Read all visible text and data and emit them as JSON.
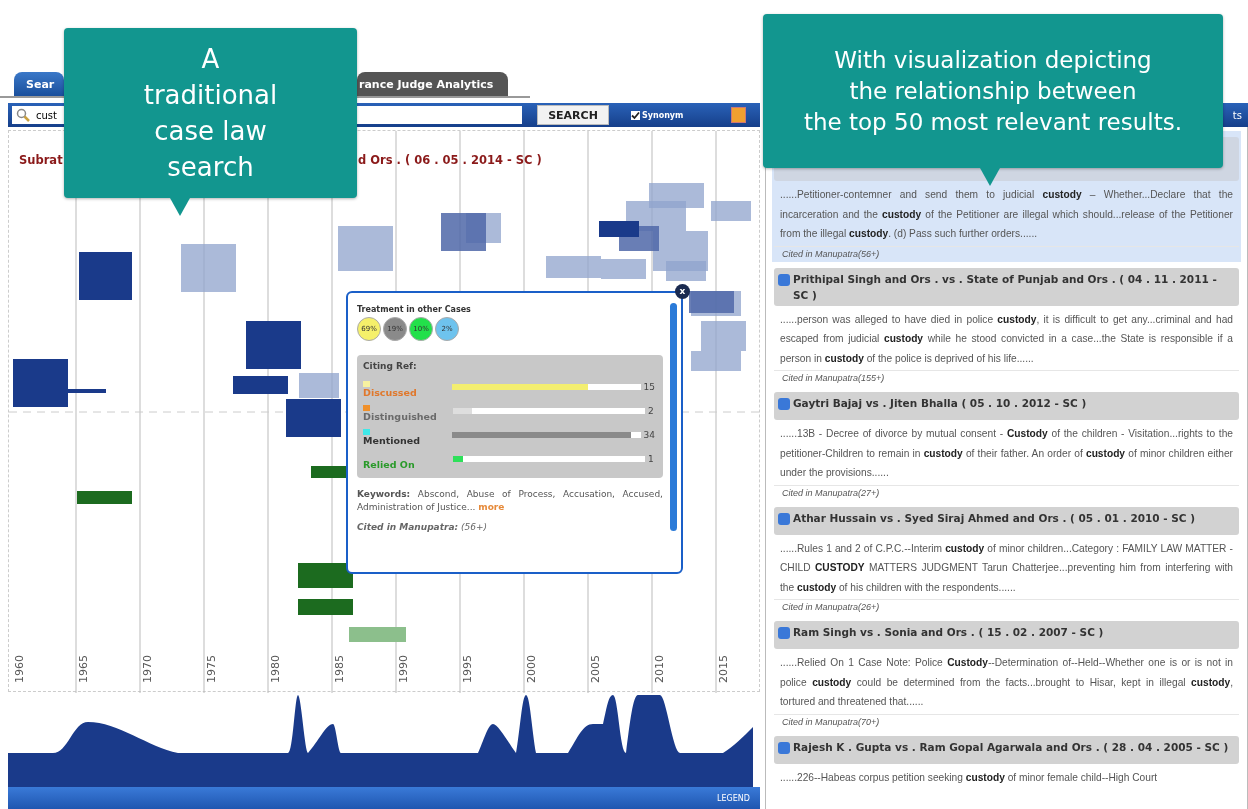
{
  "tabs": [
    {
      "label": "Sear",
      "selected": true
    },
    {
      "label": "rance Judge Analytics",
      "selected": false
    }
  ],
  "search": {
    "value": "cust",
    "button": "SEARCH",
    "synonym": {
      "label": "Synonym",
      "checked": true
    }
  },
  "timeline": {
    "title_parts": [
      "Subrat",
      "d Ors . ( 06 . 05 . 2014 - SC )"
    ],
    "years": [
      "1960",
      "1965",
      "1970",
      "1975",
      "1980",
      "1985",
      "1990",
      "1995",
      "2000",
      "2005",
      "2010",
      "2015"
    ]
  },
  "popup": {
    "close": "x",
    "treatment_title": "Treatment in other Cases",
    "treatments": [
      {
        "label": "69%",
        "color": "#f5f06a"
      },
      {
        "label": "19%",
        "color": "#8a8a8a"
      },
      {
        "label": "10%",
        "color": "#22e04a"
      },
      {
        "label": "2%",
        "color": "#6ec3ee"
      }
    ],
    "citing_title": "Citing Ref:",
    "citing": [
      {
        "kind": "discussed",
        "label": "Discussed",
        "value": "15",
        "level": 0.72,
        "color": "#f3ee70"
      },
      {
        "kind": "distinguished",
        "label": "Distinguished",
        "value": "2",
        "level": 0.1,
        "color": "#dedede"
      },
      {
        "kind": "mentioned",
        "label": "Mentioned",
        "value": "34",
        "level": 0.95,
        "color": "#8a8a8a"
      },
      {
        "kind": "relied",
        "label": "Relied On",
        "value": "1",
        "level": 0.05,
        "color": "#2ee05a"
      }
    ],
    "keywords": "**Keywords:** Abscond, Abuse of Process, Accusation, Accused, Administration of Justice...",
    "more": "more",
    "cited": "**Cited in Manupatra:** (56+)"
  },
  "legend": "LEGEND",
  "results_bar": "ts",
  "results": [
    {
      "selected": true,
      "snippet": "......Petitioner-contemner and send them to judicial **custody** – Whether...Declare that the incarceration and the **custody** of the Petitioner are illegal which should...release of the Petitioner from the illegal **custody**. (d) Pass such further orders......",
      "cited": "Cited in Manupatra(56+)"
    },
    {
      "selected": false,
      "title": "Prithipal Singh and Ors . vs . State of Punjab and Ors . ( 04 . 11 . 2011 - SC )",
      "snippet": "......person was alleged to have died in police **custody**, it is difficult to get any...criminal and had escaped from judicial **custody** while he stood convicted in a case...the State is responsible if a person in **custody** of the police is deprived of his life......",
      "cited": "Cited in Manupatra(155+)"
    },
    {
      "selected": false,
      "title": "Gaytri Bajaj vs . Jiten Bhalla ( 05 . 10 . 2012 - SC )",
      "snippet": "......13B - Decree of divorce by mutual consent - **Custody** of the children - Visitation...rights to the petitioner-Children to remain in **custody** of their father. An order of **custody** of minor children either under the provisions......",
      "cited": "Cited in Manupatra(27+)"
    },
    {
      "selected": false,
      "title": "Athar Hussain vs . Syed Siraj Ahmed and Ors . ( 05 . 01 . 2010 - SC )",
      "snippet": "......Rules 1 and 2 of C.P.C.--Interim **custody** of minor children...Category : FAMILY LAW MATTER - CHILD **CUSTODY** MATTERS JUDGMENT Tarun Chatterjee...preventing him from interfering with the **custody** of his children with the respondents......",
      "cited": "Cited in Manupatra(26+)"
    },
    {
      "selected": false,
      "title": "Ram Singh vs . Sonia and Ors . ( 15 . 02 . 2007 - SC )",
      "snippet": "......Relied On 1 Case Note: Police **Custody**--Determination of--Held--Whether one is or is not in police **custody** could be determined from the facts...brought to Hisar, kept in illegal **custody**, tortured and threatened that......",
      "cited": "Cited in Manupatra(70+)"
    },
    {
      "selected": false,
      "title": "Rajesh K . Gupta vs . Ram Gopal Agarwala and Ors . ( 28 . 04 . 2005 - SC )",
      "snippet": "......226--Habeas corpus petition seeking **custody** of minor female child--High Court"
    }
  ],
  "callouts": [
    {
      "lines": [
        "A",
        "traditional",
        "case law",
        "search"
      ]
    },
    {
      "lines": [
        "With visualization depicting",
        "the relationship between",
        "the top 50 most relevant results."
      ]
    }
  ]
}
